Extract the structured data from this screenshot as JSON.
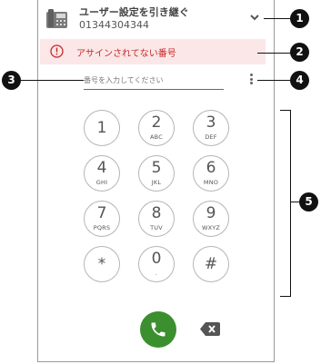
{
  "header": {
    "title": "ユーザー設定を引き継ぐ",
    "number": "01344304344"
  },
  "alert": {
    "text": "アサインされてない番号"
  },
  "dial_input": {
    "placeholder": "番号を入力してください",
    "value": ""
  },
  "keypad": [
    {
      "digit": "1",
      "letters": ""
    },
    {
      "digit": "2",
      "letters": "ABC"
    },
    {
      "digit": "3",
      "letters": "DEF"
    },
    {
      "digit": "4",
      "letters": "GHI"
    },
    {
      "digit": "5",
      "letters": "JKL"
    },
    {
      "digit": "6",
      "letters": "MNO"
    },
    {
      "digit": "7",
      "letters": "PQRS"
    },
    {
      "digit": "8",
      "letters": "TUV"
    },
    {
      "digit": "9",
      "letters": "WXYZ"
    },
    {
      "digit": "*",
      "letters": ""
    },
    {
      "digit": "0",
      "letters": "."
    },
    {
      "digit": "#",
      "letters": ""
    }
  ],
  "callouts": [
    "1",
    "2",
    "3",
    "4",
    "5"
  ],
  "colors": {
    "accent": "#3b8f2f",
    "alert_bg": "#fbe7e7",
    "alert_text": "#c62828"
  }
}
